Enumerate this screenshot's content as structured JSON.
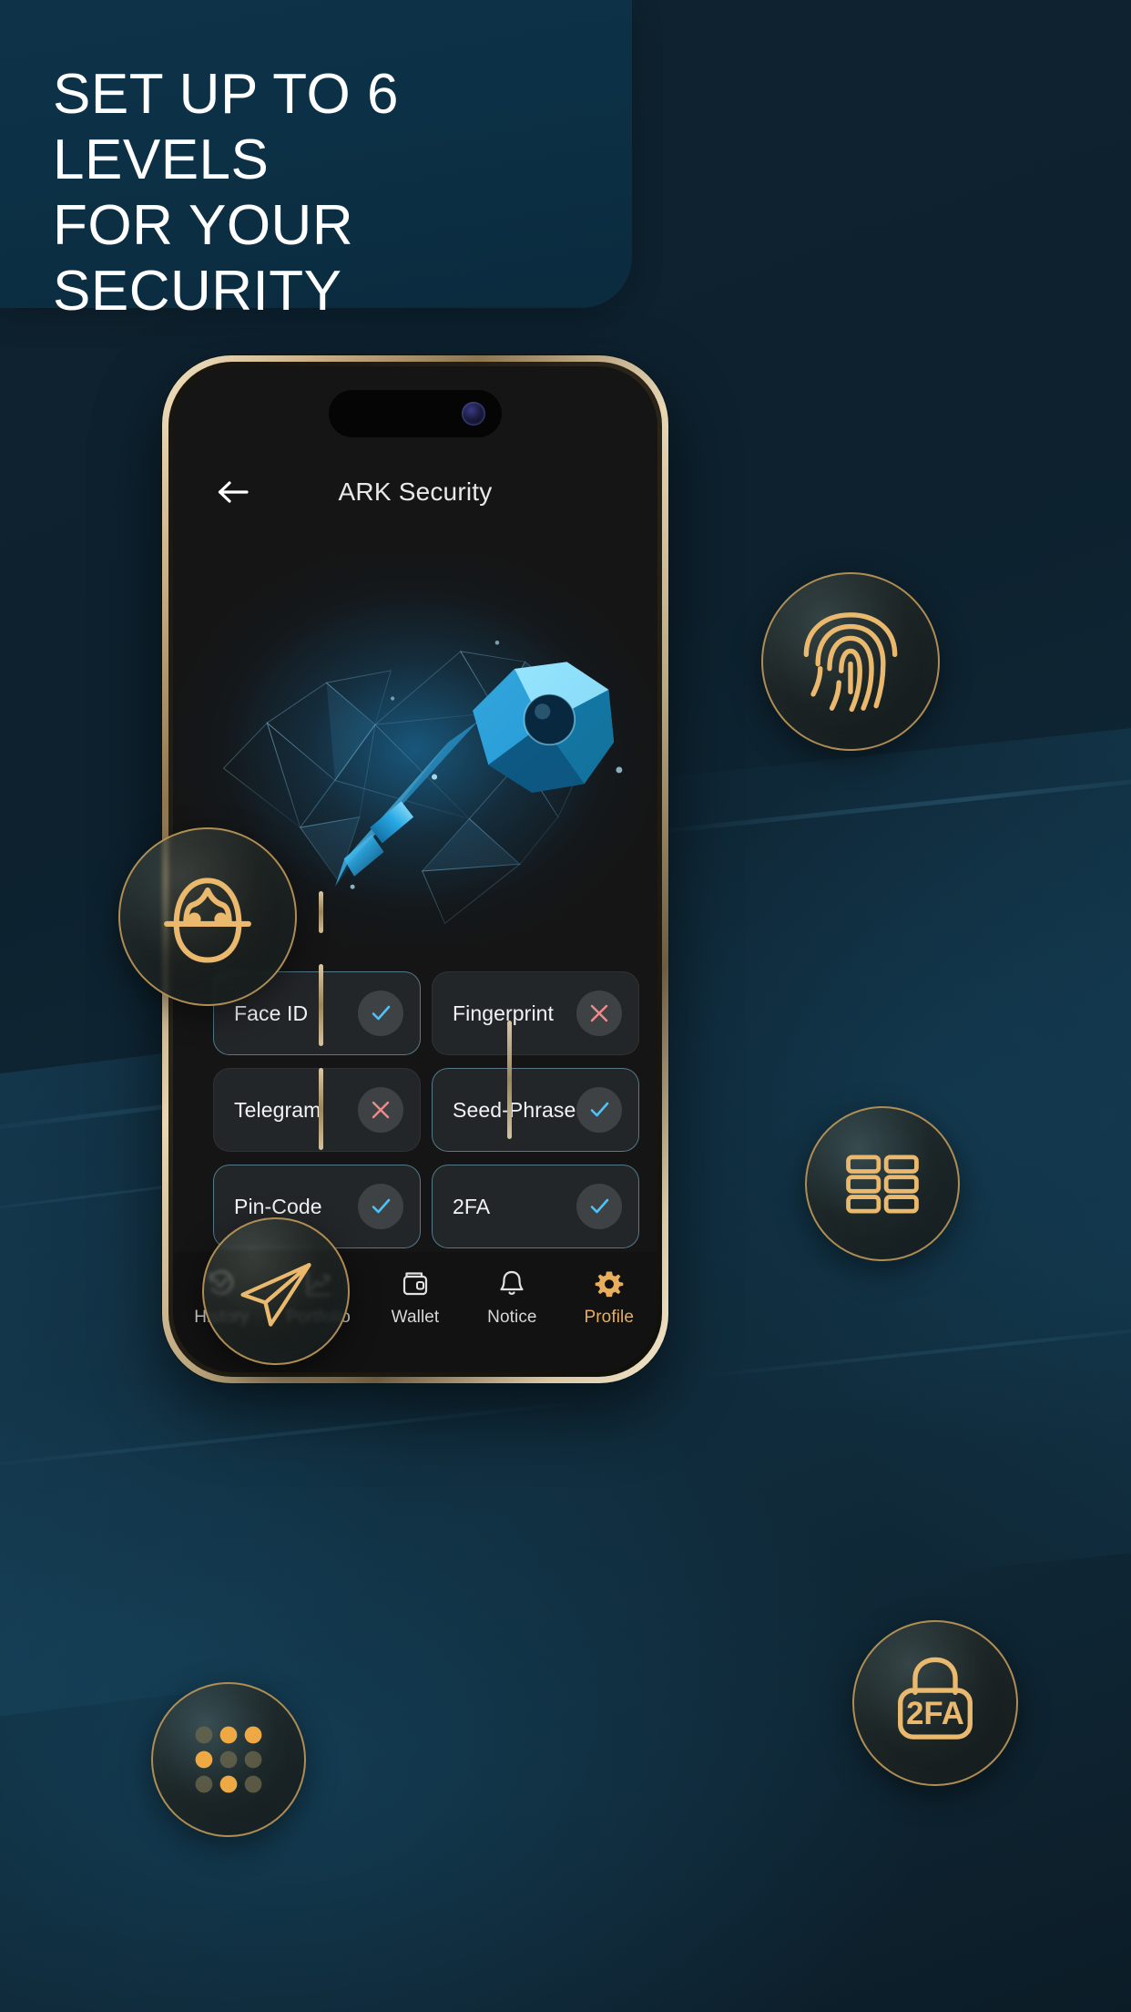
{
  "promo": {
    "headline": "SET UP TO 6 LEVELS\nFOR YOUR SECURITY",
    "headline_line1": "SET UP TO 6 LEVELS",
    "headline_line2": "FOR YOUR SECURITY",
    "background_color": "#0d1f2b",
    "panel_color": "#0e3248",
    "accent_gold": "#e8ae5d"
  },
  "app": {
    "header": {
      "title": "ARK Security",
      "back_icon": "arrow-left-icon"
    },
    "hero": {
      "artwork_name": "crystal-key-illustration",
      "glow_color": "#1b8cce"
    },
    "security_options": [
      {
        "label": "Face ID",
        "state": "enabled",
        "icon": "check-icon",
        "icon_color": "#4fc3f7"
      },
      {
        "label": "Fingerprint",
        "state": "disabled",
        "icon": "cross-icon",
        "icon_color": "#ef8a8a"
      },
      {
        "label": "Telegram",
        "state": "disabled",
        "icon": "cross-icon",
        "icon_color": "#ef8a8a"
      },
      {
        "label": "Seed-Phrase",
        "state": "enabled",
        "icon": "check-icon",
        "icon_color": "#4fc3f7"
      },
      {
        "label": "Pin-Code",
        "state": "enabled",
        "icon": "check-icon",
        "icon_color": "#4fc3f7"
      },
      {
        "label": "2FA",
        "state": "enabled",
        "icon": "check-icon",
        "icon_color": "#4fc3f7"
      }
    ],
    "bottom_nav": [
      {
        "label": "History",
        "icon": "history-clock-icon",
        "active": false
      },
      {
        "label": "Portfolio",
        "icon": "trending-chart-icon",
        "active": false
      },
      {
        "label": "Wallet",
        "icon": "wallet-icon",
        "active": false
      },
      {
        "label": "Notice",
        "icon": "bell-icon",
        "active": false
      },
      {
        "label": "Profile",
        "icon": "gear-icon",
        "active": true
      }
    ]
  },
  "floating_badges": [
    {
      "name": "fingerprint",
      "icon": "fingerprint-icon",
      "label": "Fingerprint"
    },
    {
      "name": "faceid",
      "icon": "face-scan-icon",
      "label": "Face ID"
    },
    {
      "name": "seedphrase",
      "icon": "word-grid-icon",
      "label": "Seed-Phrase"
    },
    {
      "name": "telegram",
      "icon": "paper-plane-icon",
      "label": "Telegram"
    },
    {
      "name": "twofa",
      "icon": "padlock-2fa-icon",
      "label": "2FA",
      "text": "2FA"
    },
    {
      "name": "pincode",
      "icon": "dot-grid-icon",
      "label": "Pin-Code"
    }
  ]
}
